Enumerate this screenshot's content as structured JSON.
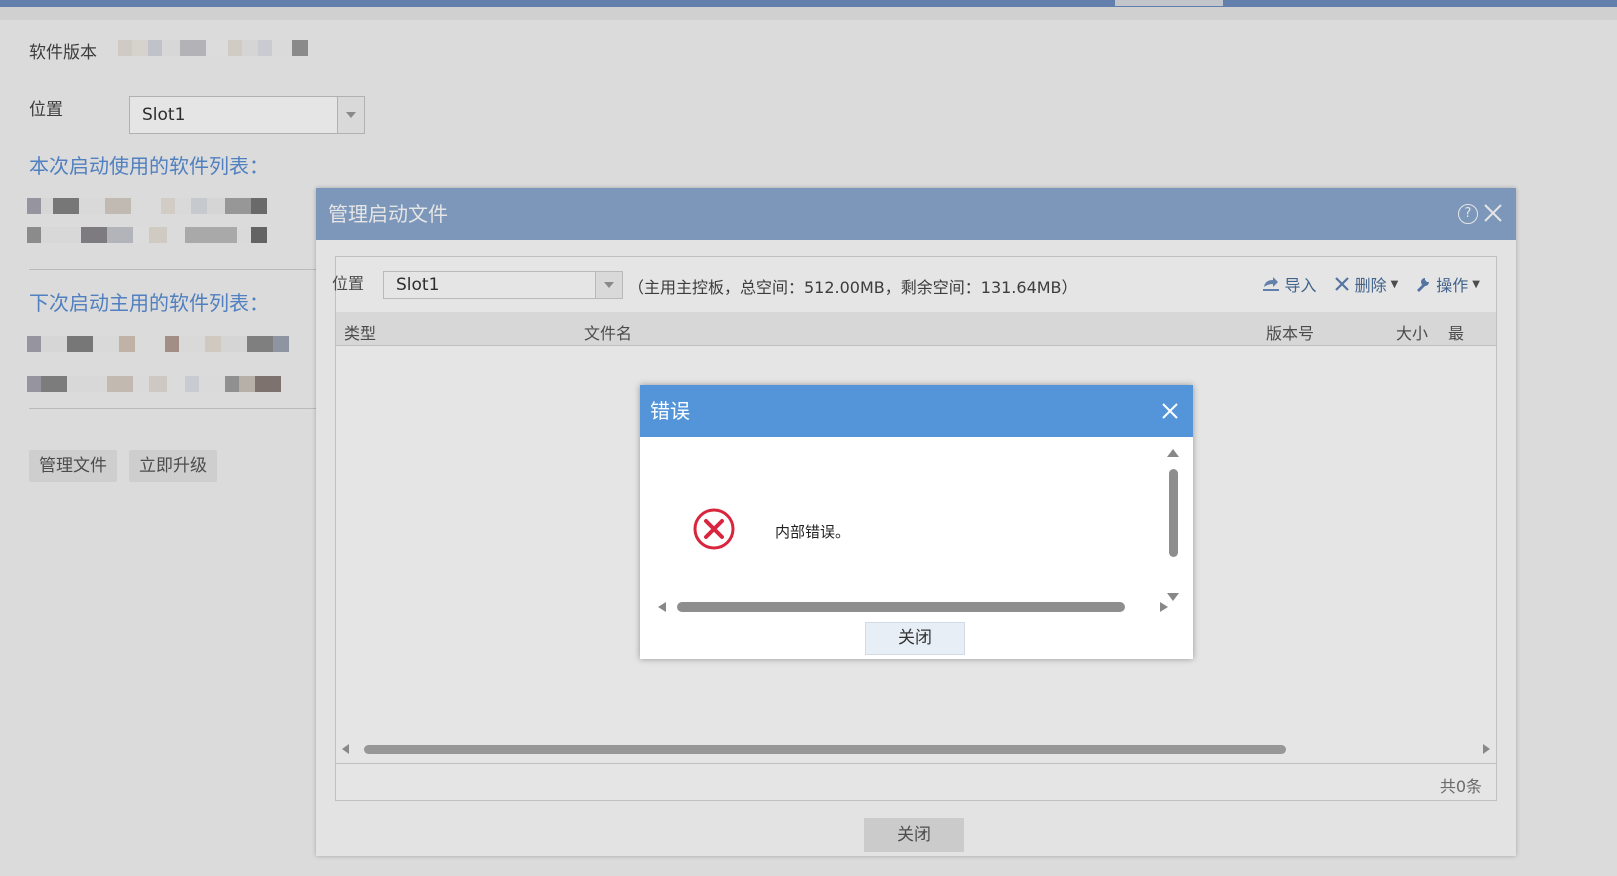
{
  "page": {
    "software_version_label": "软件版本",
    "location_label": "位置",
    "location_value": "Slot1",
    "current_boot_title": "本次启动使用的软件列表：",
    "next_boot_title": "下次启动主用的软件列表：",
    "buttons": {
      "manage_files": "管理文件",
      "upgrade_now": "立即升级"
    }
  },
  "manage_dialog": {
    "title": "管理启动文件",
    "help_glyph": "?",
    "location_label": "位置",
    "location_value": "Slot1",
    "space_info": "（主用主控板，总空间：512.00MB，剩余空间：131.64MB）",
    "toolbar": {
      "import": "导入",
      "delete": "删除",
      "operate": "操作"
    },
    "columns": [
      "类型",
      "文件名",
      "版本号",
      "大小",
      "最"
    ],
    "rows": [],
    "total_text": "共0条",
    "close_label": "关闭"
  },
  "error_dialog": {
    "title": "错误",
    "message": "内部错误。",
    "close_label": "关闭",
    "icon": "error-x-circle-icon",
    "colors": {
      "header": "#5495da",
      "error": "#d9263f"
    }
  },
  "colors": {
    "top_bar": "#6f8fc1",
    "manage_dialog_header": "#8ba9d0",
    "section_title": "#5b8fd6"
  }
}
